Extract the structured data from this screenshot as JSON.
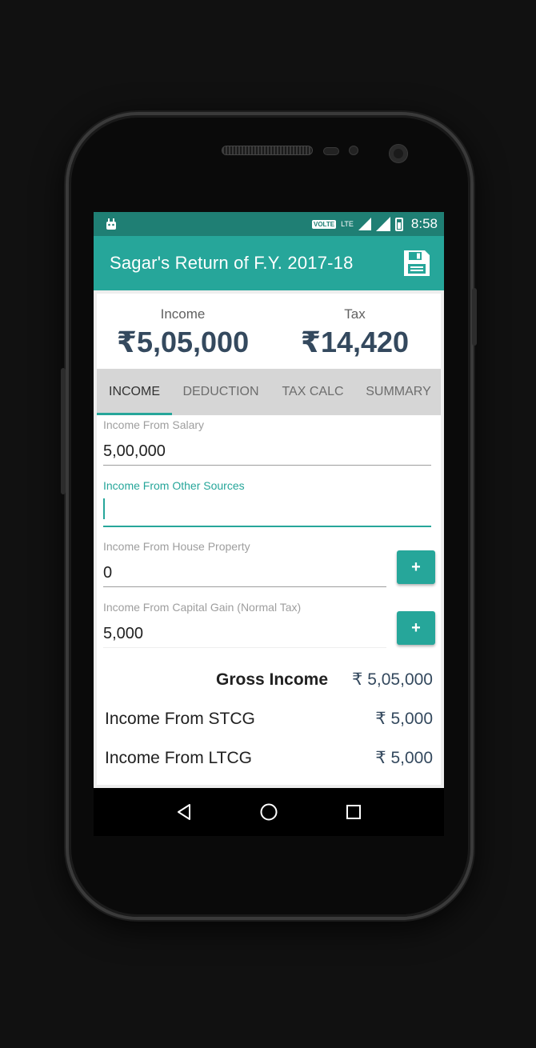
{
  "status_bar": {
    "volte": "VOLTE",
    "lte": "LTE",
    "time": "8:58",
    "icons": [
      "android-icon",
      "volte-icon",
      "lte-icon",
      "signal-icon",
      "signal-icon",
      "battery-charging-icon"
    ]
  },
  "app_bar": {
    "title": "Sagar's Return of F.Y. 2017-18",
    "save_icon": "floppy-save-icon"
  },
  "summary": {
    "income_label": "Income",
    "income_value": "₹5,05,000",
    "tax_label": "Tax",
    "tax_value": "₹14,420"
  },
  "tabs": [
    {
      "label": "INCOME",
      "active": true
    },
    {
      "label": "DEDUCTION",
      "active": false
    },
    {
      "label": "TAX CALC",
      "active": false
    },
    {
      "label": "SUMMARY",
      "active": false
    }
  ],
  "form": {
    "salary": {
      "label": "Income From Salary",
      "value": "5,00,000"
    },
    "other_sources": {
      "label": "Income From Other Sources",
      "value": ""
    },
    "house_property": {
      "label": "Income From House Property",
      "value": "0",
      "button": "+"
    },
    "capital_gain": {
      "label": "Income From Capital Gain (Normal Tax)",
      "value": "5,000",
      "button": "+"
    }
  },
  "totals": {
    "gross_label": "Gross Income",
    "gross_value": "₹ 5,05,000",
    "stcg_label": "Income From STCG",
    "stcg_value": "₹ 5,000",
    "ltcg_label": "Income From LTCG",
    "ltcg_value": "₹ 5,000"
  },
  "nav": {
    "icons": [
      "back-icon",
      "home-icon",
      "recents-icon"
    ]
  },
  "colors": {
    "primary": "#26a69a",
    "primary_dark": "#1f7f74",
    "value_text": "#34495e",
    "tab_bg": "#d6d6d6"
  }
}
